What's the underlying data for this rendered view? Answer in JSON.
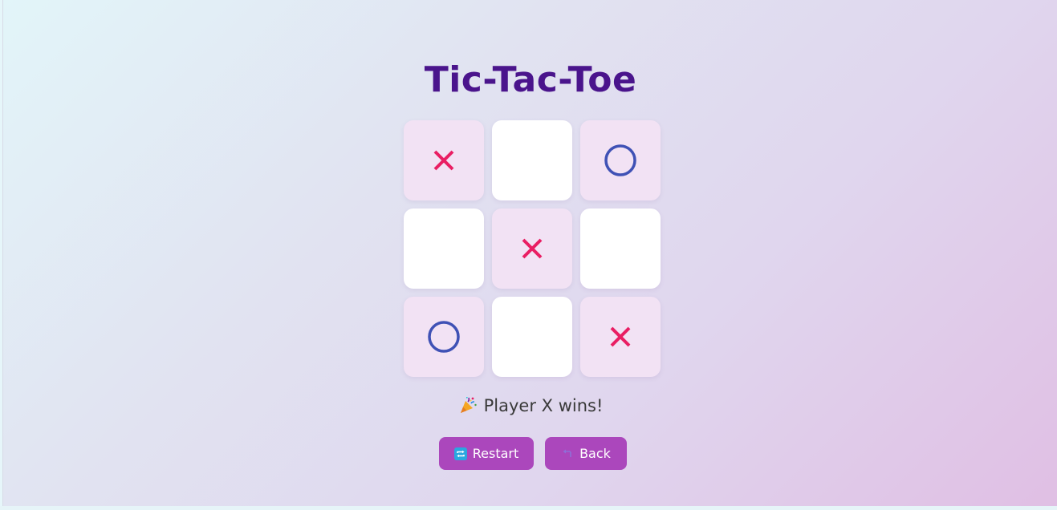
{
  "title": "Tic-Tac-Toe",
  "board": {
    "cells": [
      "X",
      "",
      "O",
      "",
      "X",
      "",
      "O",
      "",
      "X"
    ]
  },
  "status": {
    "icon": "party-popper-icon",
    "text": "Player X wins!"
  },
  "buttons": {
    "restart": {
      "label": "Restart",
      "icon": "repeat-icon"
    },
    "back": {
      "label": "Back",
      "icon": "back-arrow-icon"
    }
  },
  "colors": {
    "title": "#4a148c",
    "x_mark": "#e91e63",
    "o_mark": "#3f51b5",
    "button": "#ab47bc",
    "filled_cell": "#f2e2f4",
    "empty_cell": "#ffffff"
  }
}
